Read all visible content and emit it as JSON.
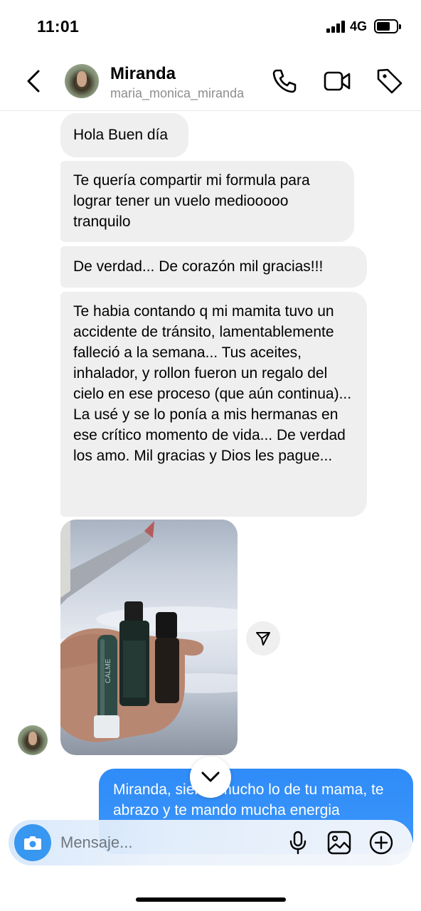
{
  "status_bar": {
    "time": "11:01",
    "network": "4G"
  },
  "header": {
    "back_icon": "chevron-left-icon",
    "name": "Miranda",
    "username": "maria_monica_miranda",
    "icons": [
      "phone-icon",
      "video-camera-icon",
      "tag-icon"
    ]
  },
  "messages": [
    {
      "text": "Hola Buen día"
    },
    {
      "text": "Te quería compartir mi formula para lograr tener un vuelo mediooooo tranquilo"
    },
    {
      "text": "De verdad...  De corazón mil gracias!!!"
    },
    {
      "text": "Te habia contando q mi mamita tuvo un accidente de tránsito, lamentablemente falleció a la semana... Tus aceites, inhalador, y rollon fueron un regalo del cielo en ese proceso (que aún continua)... La usé y se lo ponía a mis hermanas en ese crítico momento de vida... De verdad los amo. Mil gracias y Dios les pague..."
    }
  ],
  "photo_label": "CALME",
  "outgoing_message": "Miranda, siento mucho lo de tu mama, te abrazo y te mando mucha energia",
  "composer": {
    "placeholder": "Mensaje...",
    "icons": [
      "camera-icon",
      "microphone-icon",
      "gallery-icon",
      "add-icon"
    ]
  },
  "colors": {
    "accent": "#3897f0",
    "outgoing_bubble": "#3c97fb",
    "incoming_bubble": "#efefef"
  }
}
